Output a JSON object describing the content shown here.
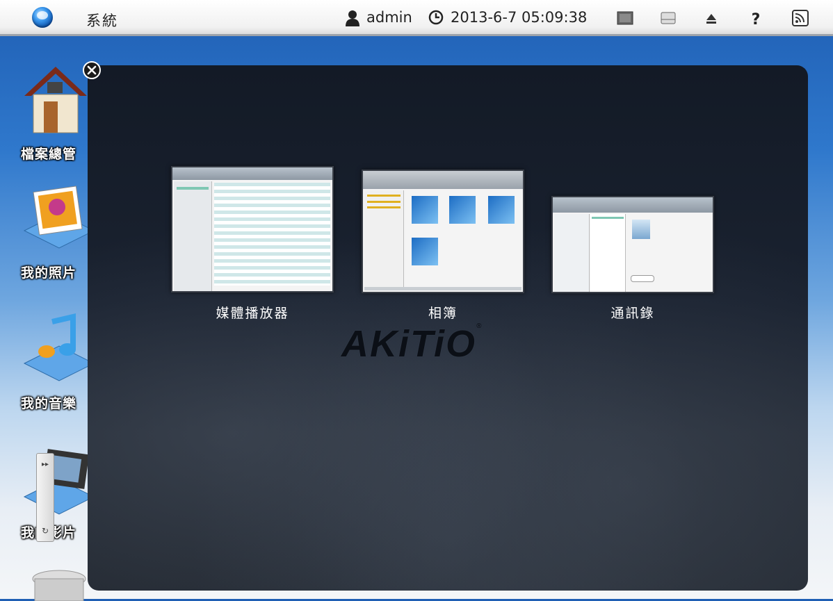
{
  "topbar": {
    "title": "系統",
    "user": "admin",
    "datetime": "2013-6-7 05:09:38",
    "icons": [
      "system-logo-icon",
      "user-icon",
      "clock-icon",
      "screen-icon",
      "drive-icon",
      "eject-icon",
      "help-icon",
      "rss-icon"
    ]
  },
  "desktop": {
    "items": [
      {
        "label": "檔案總管",
        "icon": "house-icon"
      },
      {
        "label": "我的照片",
        "icon": "photo-icon"
      },
      {
        "label": "我的音樂",
        "icon": "music-icon"
      },
      {
        "label": "我的影片",
        "icon": "film-icon"
      },
      {
        "label": "",
        "icon": "trash-icon"
      }
    ]
  },
  "switcher": {
    "windows": [
      {
        "label": "媒體播放器"
      },
      {
        "label": "相簿"
      },
      {
        "label": "通訊錄"
      }
    ],
    "brand": "AKiTiO",
    "close_icon": "close-icon"
  },
  "colors": {
    "accent": "#2f78cc",
    "overlay": "#1a2230"
  }
}
